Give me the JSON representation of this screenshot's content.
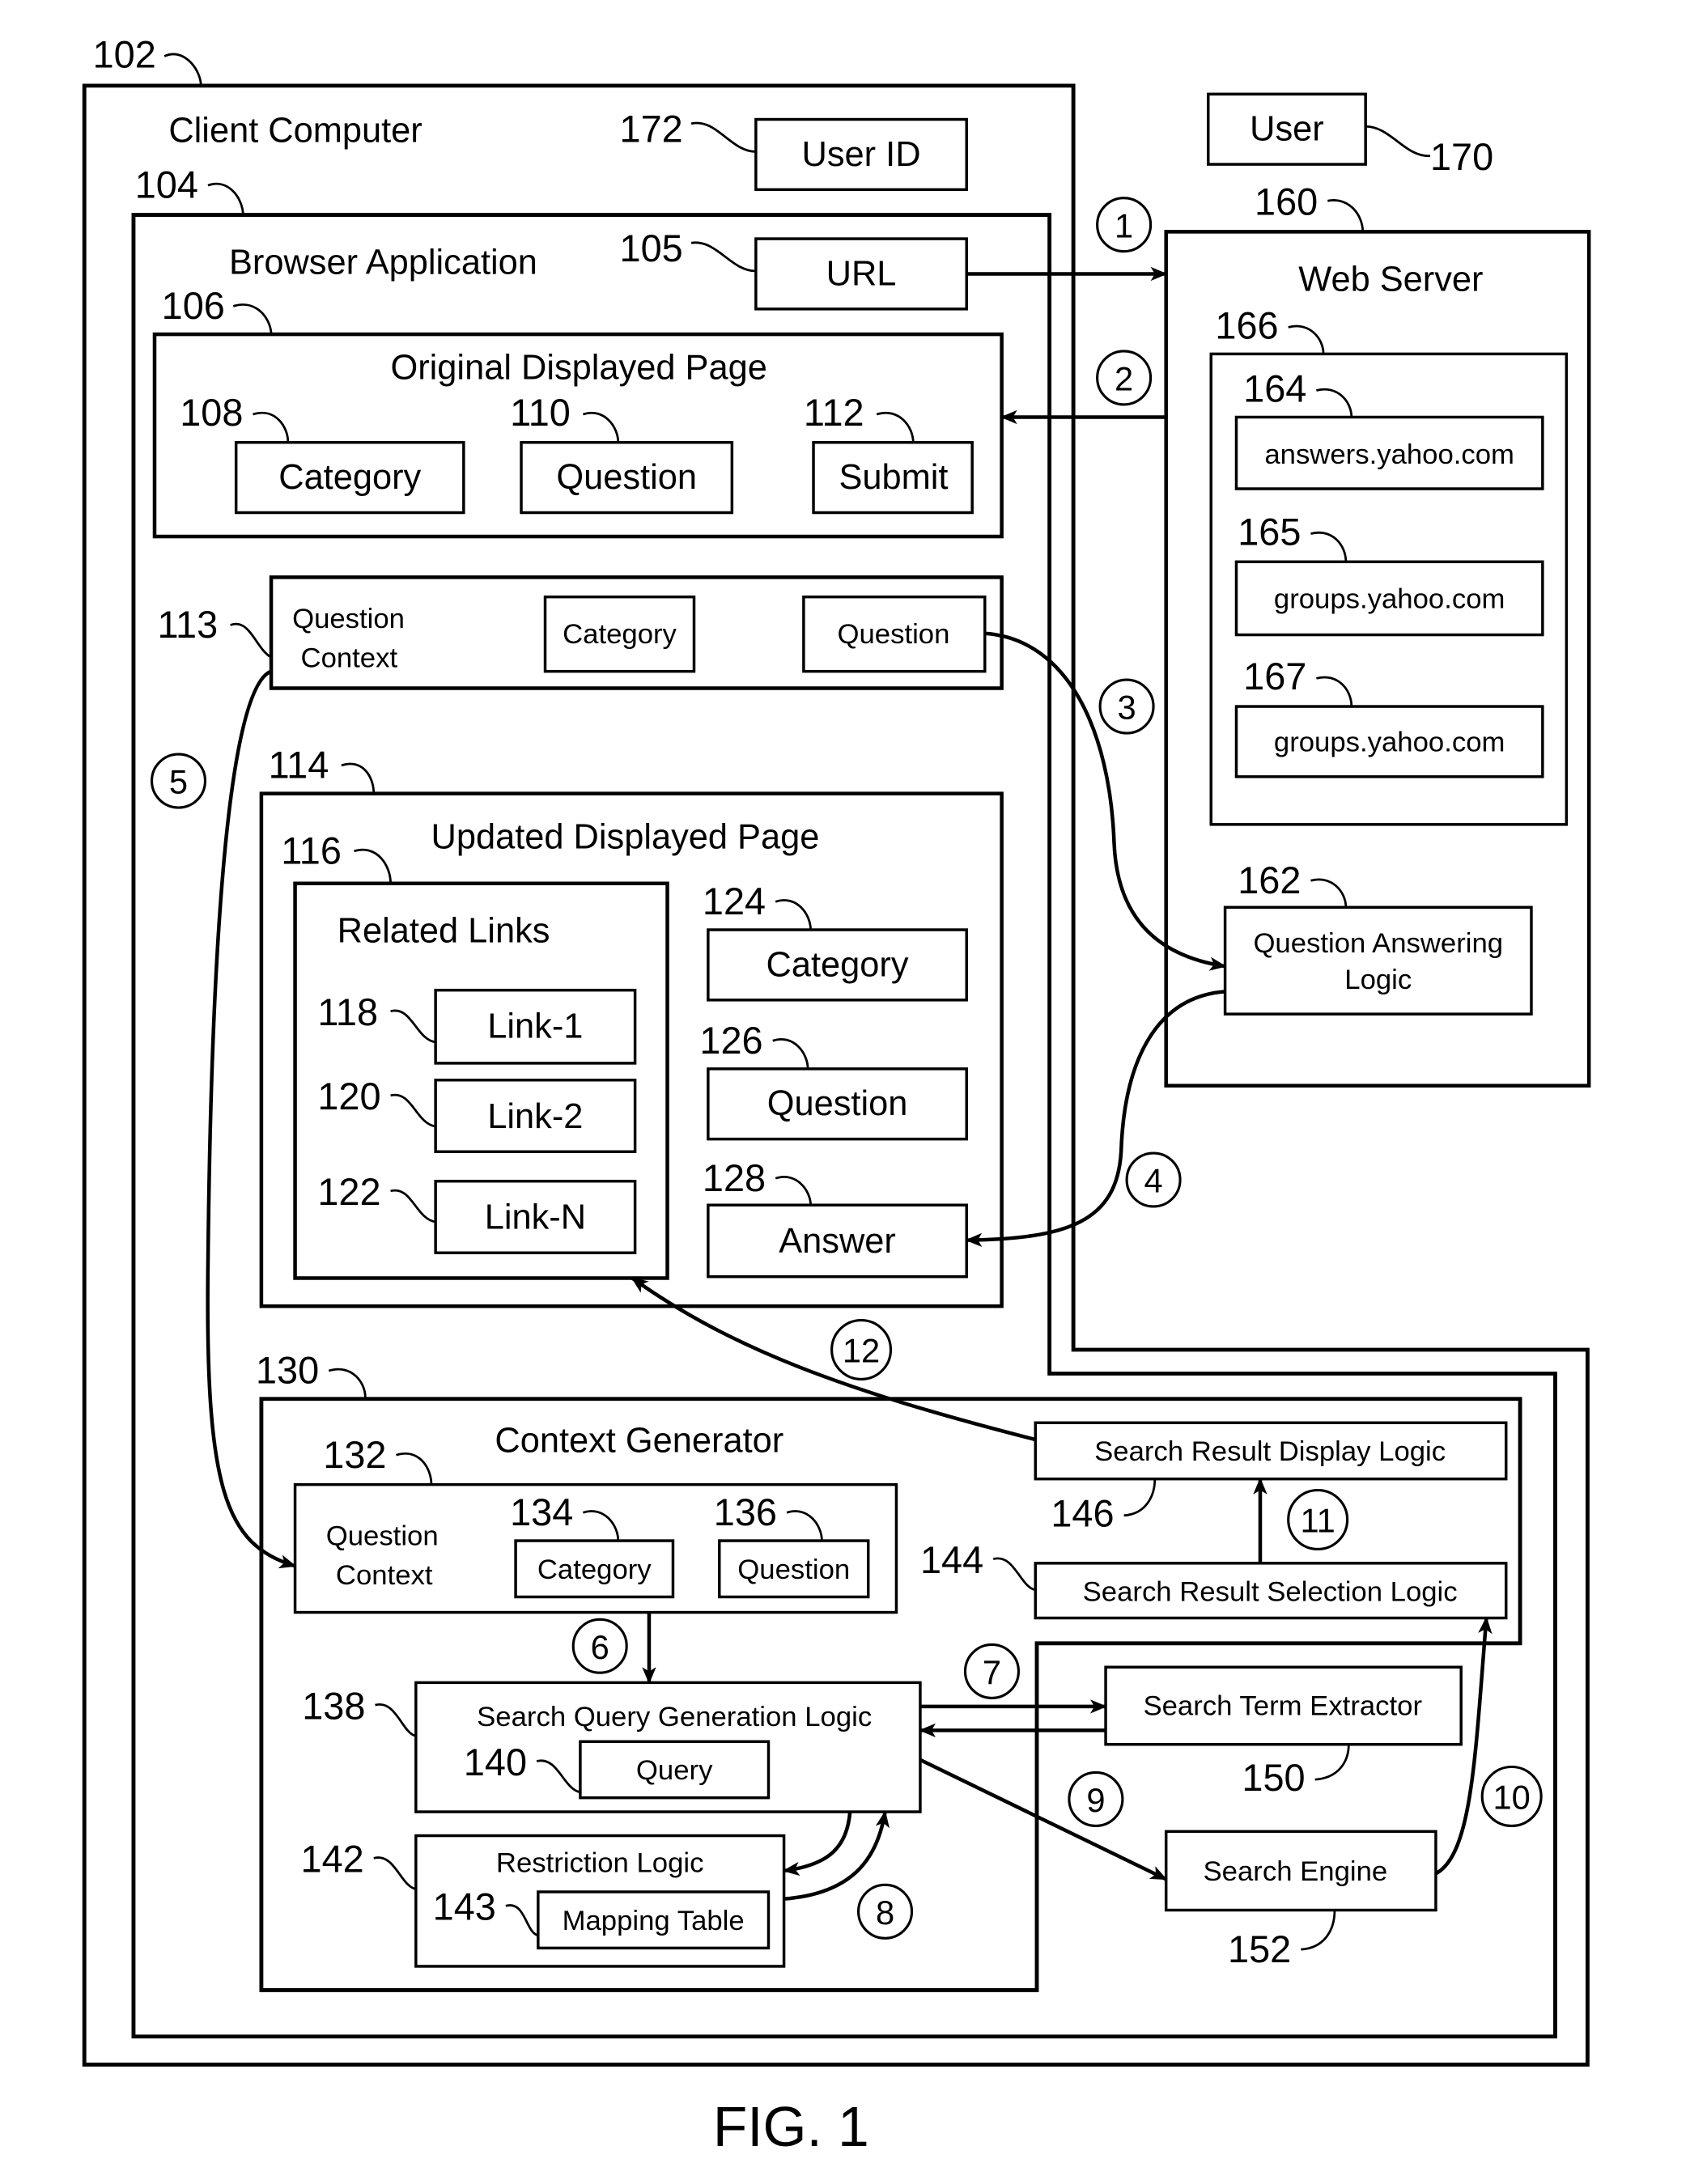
{
  "figure": {
    "caption": "FIG. 1"
  },
  "client_computer": {
    "ref": "102",
    "title": "Client Computer"
  },
  "user_id": {
    "ref": "172",
    "label": "User ID"
  },
  "browser": {
    "ref": "104",
    "title": "Browser Application"
  },
  "url": {
    "ref": "105",
    "label": "URL"
  },
  "original_page": {
    "ref": "106",
    "title": "Original Displayed Page",
    "fields": [
      {
        "ref": "108",
        "label": "Category"
      },
      {
        "ref": "110",
        "label": "Question"
      },
      {
        "ref": "112",
        "label": "Submit"
      }
    ]
  },
  "question_context_113": {
    "ref": "113",
    "title_line1": "Question",
    "title_line2": "Context",
    "category": "Category",
    "question": "Question"
  },
  "updated_page": {
    "ref": "114",
    "title": "Updated Displayed Page",
    "related_links": {
      "ref": "116",
      "title": "Related Links",
      "links": [
        {
          "ref": "118",
          "label": "Link-1"
        },
        {
          "ref": "120",
          "label": "Link-2"
        },
        {
          "ref": "122",
          "label": "Link-N"
        }
      ]
    },
    "fields": [
      {
        "ref": "124",
        "label": "Category"
      },
      {
        "ref": "126",
        "label": "Question"
      },
      {
        "ref": "128",
        "label": "Answer"
      }
    ]
  },
  "context_generator": {
    "ref": "130",
    "title": "Context Generator",
    "question_context": {
      "ref": "132",
      "title_line1": "Question",
      "title_line2": "Context",
      "category": {
        "ref": "134",
        "label": "Category"
      },
      "question": {
        "ref": "136",
        "label": "Question"
      }
    },
    "query_logic": {
      "ref": "138",
      "label": "Search Query Generation Logic",
      "query": {
        "ref": "140",
        "label": "Query"
      }
    },
    "restriction_logic": {
      "ref": "142",
      "label": "Restriction Logic",
      "mapping_table": {
        "ref": "143",
        "label": "Mapping Table"
      }
    },
    "display_logic": {
      "ref": "146",
      "label": "Search Result Display Logic"
    },
    "selection_logic": {
      "ref": "144",
      "label": "Search Result Selection Logic"
    }
  },
  "search_term_extractor": {
    "ref": "150",
    "label": "Search Term Extractor"
  },
  "search_engine": {
    "ref": "152",
    "label": "Search Engine"
  },
  "user": {
    "ref": "170",
    "label": "User"
  },
  "web_server": {
    "ref": "160",
    "title": "Web Server",
    "sites_group": {
      "ref": "166",
      "sites": [
        {
          "ref": "164",
          "label": "answers.yahoo.com"
        },
        {
          "ref": "165",
          "label": "groups.yahoo.com"
        },
        {
          "ref": "167",
          "label": "groups.yahoo.com"
        }
      ]
    },
    "qa_logic": {
      "ref": "162",
      "line1": "Question Answering",
      "line2": "Logic"
    }
  },
  "steps": [
    "1",
    "2",
    "3",
    "4",
    "5",
    "6",
    "7",
    "8",
    "9",
    "10",
    "11",
    "12"
  ]
}
